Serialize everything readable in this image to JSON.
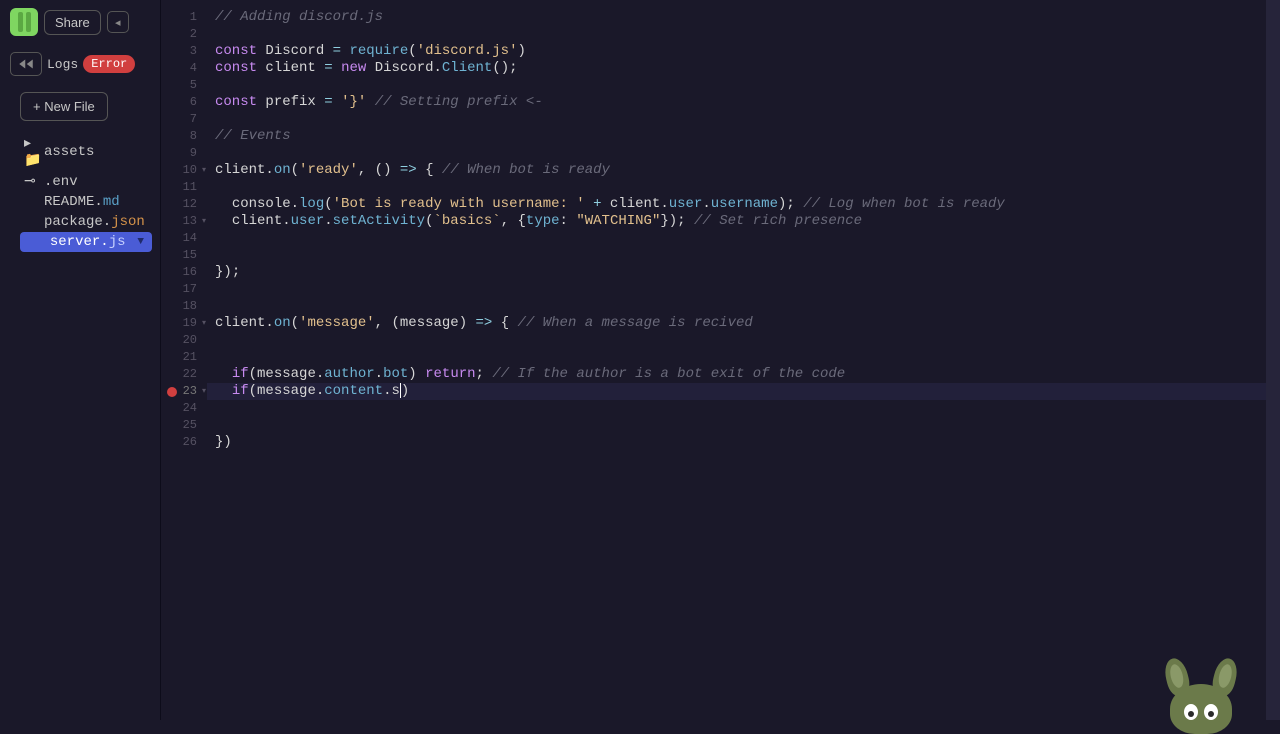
{
  "header": {
    "share_label": "Share"
  },
  "controls": {
    "logs_label": "Logs",
    "error_label": "Error"
  },
  "sidebar": {
    "new_file_label": "+ New File",
    "files": [
      {
        "icon": "folder",
        "name": "assets",
        "ext": ""
      },
      {
        "icon": "key",
        "name": ".env",
        "ext": ""
      },
      {
        "icon": "",
        "name": "README.",
        "ext": "md"
      },
      {
        "icon": "",
        "name": "package.",
        "ext": "json"
      },
      {
        "icon": "",
        "name": "server.",
        "ext": "js",
        "active": true
      }
    ]
  },
  "code": {
    "line_numbers": [
      "1",
      "2",
      "3",
      "4",
      "5",
      "6",
      "7",
      "8",
      "9",
      "10",
      "11",
      "12",
      "13",
      "14",
      "15",
      "16",
      "17",
      "18",
      "19",
      "20",
      "21",
      "22",
      "23",
      "24",
      "25",
      "26"
    ],
    "fold_lines": [
      10,
      13,
      19,
      23
    ],
    "error_line": 23,
    "current_line": 23,
    "lines": [
      [
        [
          "c-comment",
          "// Adding discord.js"
        ]
      ],
      [],
      [
        [
          "c-keyword",
          "const"
        ],
        [
          "",
          " "
        ],
        [
          "c-ident",
          "Discord"
        ],
        [
          "",
          " "
        ],
        [
          "c-op",
          "="
        ],
        [
          "",
          " "
        ],
        [
          "c-func",
          "require"
        ],
        [
          "c-paren",
          "("
        ],
        [
          "c-string",
          "'discord.js'"
        ],
        [
          "c-paren",
          ")"
        ]
      ],
      [
        [
          "c-keyword",
          "const"
        ],
        [
          "",
          " "
        ],
        [
          "c-ident",
          "client"
        ],
        [
          "",
          " "
        ],
        [
          "c-op",
          "="
        ],
        [
          "",
          " "
        ],
        [
          "c-keyword",
          "new"
        ],
        [
          "",
          " "
        ],
        [
          "c-ident",
          "Discord"
        ],
        [
          "c-ident",
          "."
        ],
        [
          "c-func",
          "Client"
        ],
        [
          "c-paren",
          "()"
        ],
        [
          "c-ident",
          ";"
        ]
      ],
      [],
      [
        [
          "c-keyword",
          "const"
        ],
        [
          "",
          " "
        ],
        [
          "c-ident",
          "prefix"
        ],
        [
          "",
          " "
        ],
        [
          "c-op",
          "="
        ],
        [
          "",
          " "
        ],
        [
          "c-string",
          "'}'"
        ],
        [
          "",
          " "
        ],
        [
          "c-comment",
          "// Setting prefix <-"
        ]
      ],
      [],
      [
        [
          "c-comment",
          "// Events"
        ]
      ],
      [],
      [
        [
          "c-ident",
          "client"
        ],
        [
          "c-ident",
          "."
        ],
        [
          "c-func",
          "on"
        ],
        [
          "c-paren",
          "("
        ],
        [
          "c-string",
          "'ready'"
        ],
        [
          "c-ident",
          ", "
        ],
        [
          "c-paren",
          "()"
        ],
        [
          "",
          " "
        ],
        [
          "c-op",
          "=>"
        ],
        [
          "",
          " "
        ],
        [
          "c-paren",
          "{"
        ],
        [
          "",
          " "
        ],
        [
          "c-comment",
          "// When bot is ready"
        ]
      ],
      [],
      [
        [
          "",
          "  "
        ],
        [
          "c-ident",
          "console"
        ],
        [
          "c-ident",
          "."
        ],
        [
          "c-func",
          "log"
        ],
        [
          "c-paren",
          "("
        ],
        [
          "c-string",
          "'Bot is ready with username: '"
        ],
        [
          "",
          " "
        ],
        [
          "c-op",
          "+"
        ],
        [
          "",
          " "
        ],
        [
          "c-ident",
          "client"
        ],
        [
          "c-ident",
          "."
        ],
        [
          "c-prop",
          "user"
        ],
        [
          "c-ident",
          "."
        ],
        [
          "c-prop",
          "username"
        ],
        [
          "c-paren",
          ")"
        ],
        [
          "c-ident",
          ";"
        ],
        [
          "",
          " "
        ],
        [
          "c-comment",
          "// Log when bot is ready"
        ]
      ],
      [
        [
          "",
          "  "
        ],
        [
          "c-ident",
          "client"
        ],
        [
          "c-ident",
          "."
        ],
        [
          "c-prop",
          "user"
        ],
        [
          "c-ident",
          "."
        ],
        [
          "c-func",
          "setActivity"
        ],
        [
          "c-paren",
          "("
        ],
        [
          "c-string",
          "`basics`"
        ],
        [
          "c-ident",
          ", "
        ],
        [
          "c-paren",
          "{"
        ],
        [
          "c-prop",
          "type"
        ],
        [
          "c-ident",
          ": "
        ],
        [
          "c-string",
          "\"WATCHING\""
        ],
        [
          "c-paren",
          "}"
        ],
        [
          "c-paren",
          ")"
        ],
        [
          "c-ident",
          ";"
        ],
        [
          "",
          " "
        ],
        [
          "c-comment",
          "// Set rich presence"
        ]
      ],
      [],
      [],
      [
        [
          "c-paren",
          "})"
        ],
        [
          "c-ident",
          ";"
        ]
      ],
      [],
      [],
      [
        [
          "c-ident",
          "client"
        ],
        [
          "c-ident",
          "."
        ],
        [
          "c-func",
          "on"
        ],
        [
          "c-paren",
          "("
        ],
        [
          "c-string",
          "'message'"
        ],
        [
          "c-ident",
          ", "
        ],
        [
          "c-paren",
          "("
        ],
        [
          "c-ident",
          "message"
        ],
        [
          "c-paren",
          ")"
        ],
        [
          "",
          " "
        ],
        [
          "c-op",
          "=>"
        ],
        [
          "",
          " "
        ],
        [
          "c-paren",
          "{"
        ],
        [
          "",
          " "
        ],
        [
          "c-comment",
          "// When a message is recived"
        ]
      ],
      [],
      [],
      [
        [
          "",
          "  "
        ],
        [
          "c-keyword",
          "if"
        ],
        [
          "c-paren",
          "("
        ],
        [
          "c-ident",
          "message"
        ],
        [
          "c-ident",
          "."
        ],
        [
          "c-prop",
          "author"
        ],
        [
          "c-ident",
          "."
        ],
        [
          "c-prop",
          "bot"
        ],
        [
          "c-paren",
          ")"
        ],
        [
          "",
          " "
        ],
        [
          "c-keyword",
          "return"
        ],
        [
          "c-ident",
          ";"
        ],
        [
          "",
          " "
        ],
        [
          "c-comment",
          "// If the author is a bot exit of the code"
        ]
      ],
      [
        [
          "",
          "  "
        ],
        [
          "c-keyword",
          "if"
        ],
        [
          "c-paren",
          "("
        ],
        [
          "c-ident",
          "message"
        ],
        [
          "c-ident",
          "."
        ],
        [
          "c-prop",
          "content"
        ],
        [
          "c-ident",
          "."
        ],
        [
          "c-ident",
          "s"
        ],
        [
          "cursor",
          ""
        ],
        [
          "c-paren",
          ")"
        ]
      ],
      [],
      [],
      [
        [
          "c-paren",
          "})"
        ]
      ]
    ]
  }
}
